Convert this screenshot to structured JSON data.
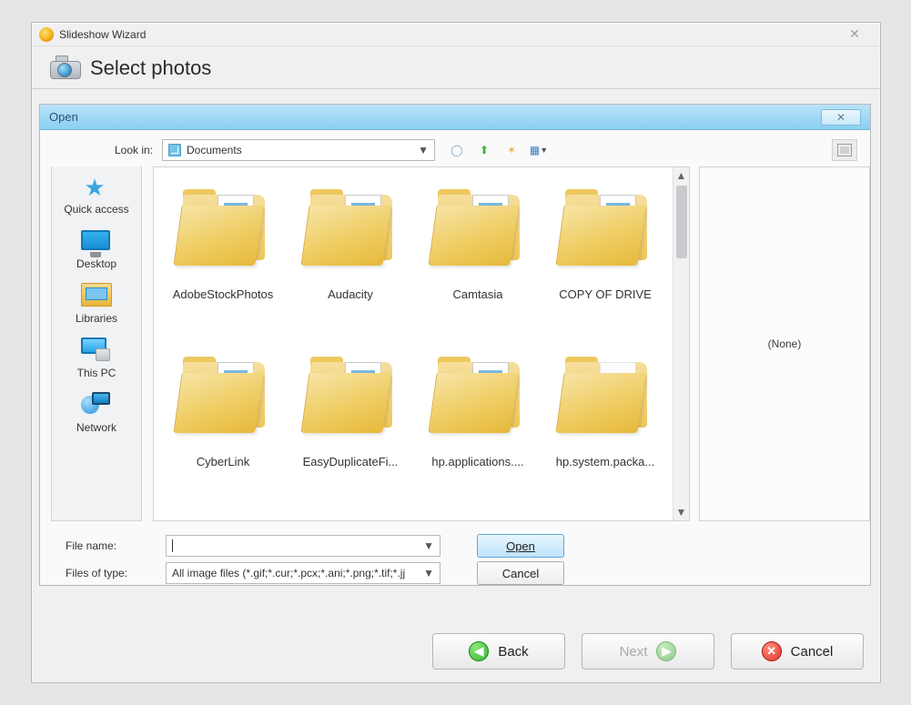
{
  "outer": {
    "title": "Slideshow Wizard",
    "heading": "Select photos"
  },
  "open": {
    "title": "Open",
    "lookin_label": "Look in:",
    "lookin_value": "Documents",
    "places": [
      {
        "label": "Quick access",
        "icon": "star"
      },
      {
        "label": "Desktop",
        "icon": "desk"
      },
      {
        "label": "Libraries",
        "icon": "lib"
      },
      {
        "label": "This PC",
        "icon": "pc"
      },
      {
        "label": "Network",
        "icon": "net"
      }
    ],
    "folders": [
      {
        "label": "AdobeStockPhotos",
        "empty": false
      },
      {
        "label": "Audacity",
        "empty": false
      },
      {
        "label": "Camtasia",
        "empty": false
      },
      {
        "label": "COPY OF DRIVE",
        "empty": false
      },
      {
        "label": "CyberLink",
        "empty": false
      },
      {
        "label": "EasyDuplicateFi...",
        "empty": false
      },
      {
        "label": "hp.applications....",
        "empty": false
      },
      {
        "label": "hp.system.packa...",
        "empty": true
      }
    ],
    "preview_text": "(None)",
    "filename_label": "File name:",
    "filename_value": "",
    "filetype_label": "Files of type:",
    "filetype_value": "All image files (*.gif;*.cur;*.pcx;*.ani;*.png;*.tif;*.jj",
    "open_btn": "Open",
    "cancel_btn": "Cancel"
  },
  "wizard": {
    "back": "Back",
    "next": "Next",
    "cancel": "Cancel"
  }
}
